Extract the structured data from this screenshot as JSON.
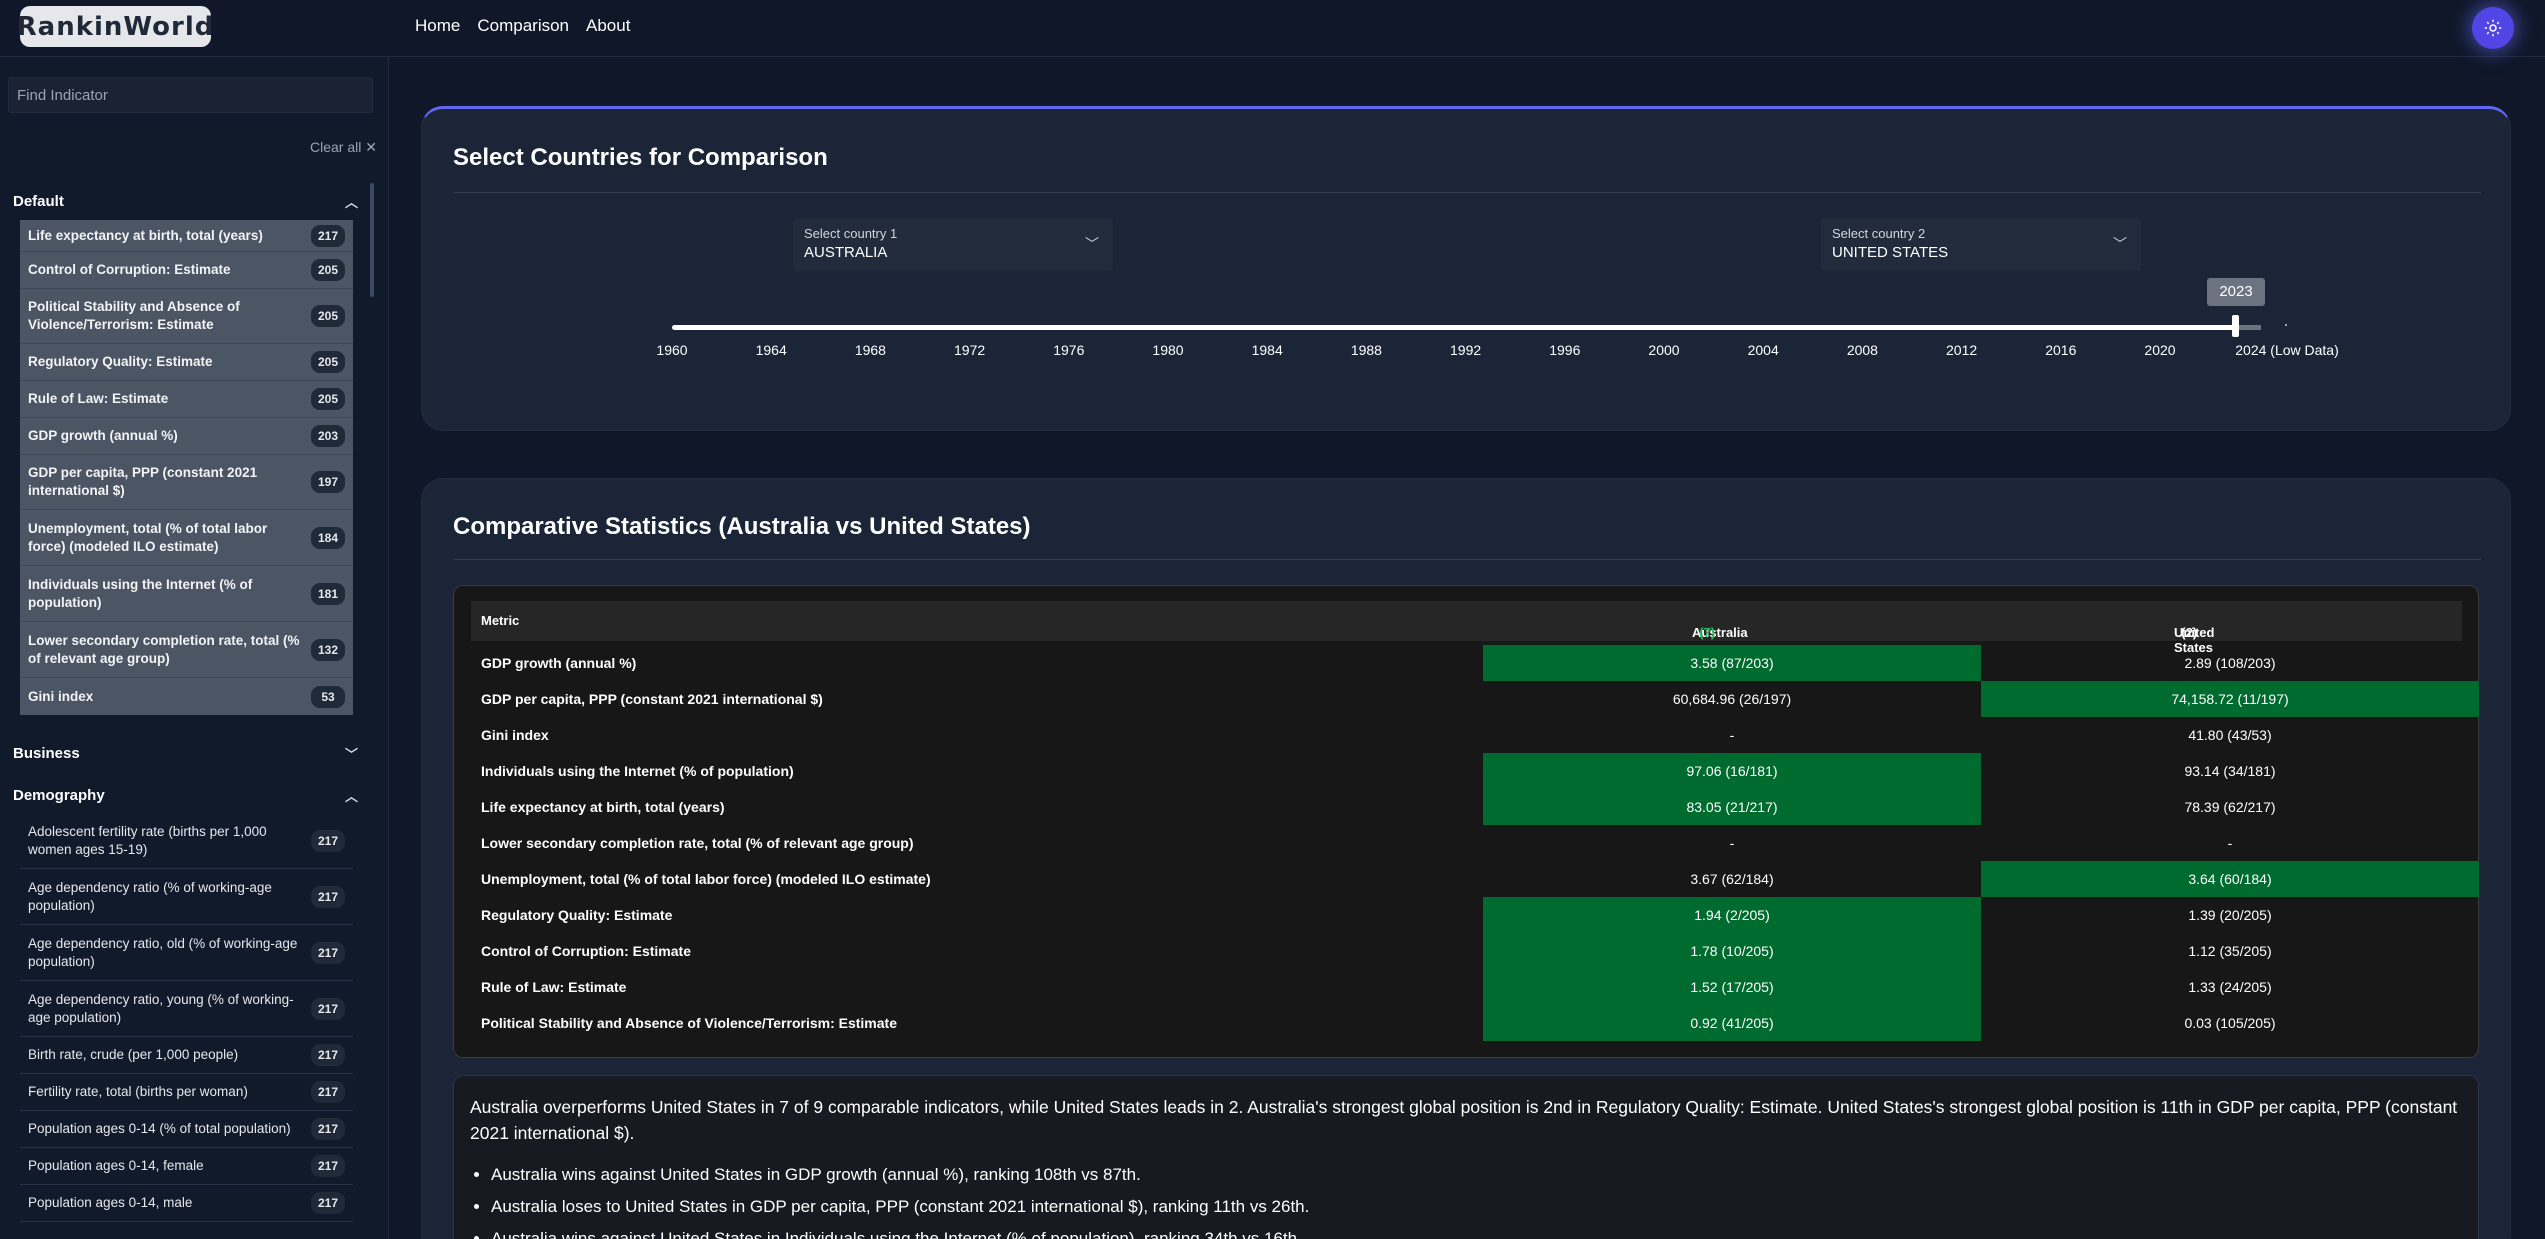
{
  "header": {
    "logo": "RankinWorld",
    "nav": [
      "Home",
      "Comparison",
      "About"
    ],
    "theme_icon": "sun-icon"
  },
  "sidebar": {
    "search_placeholder": "Find Indicator",
    "clear_all": "Clear all ✕",
    "sections": {
      "default": "Default",
      "business": "Business",
      "demography": "Demography"
    },
    "default_items": [
      {
        "label": "Life expectancy at birth, total (years)",
        "count": "217"
      },
      {
        "label": "Control of Corruption: Estimate",
        "count": "205"
      },
      {
        "label": "Political Stability and Absence of Violence/Terrorism: Estimate",
        "count": "205"
      },
      {
        "label": "Regulatory Quality: Estimate",
        "count": "205"
      },
      {
        "label": "Rule of Law: Estimate",
        "count": "205"
      },
      {
        "label": "GDP growth (annual %)",
        "count": "203"
      },
      {
        "label": "GDP per capita, PPP (constant 2021 international $)",
        "count": "197"
      },
      {
        "label": "Unemployment, total (% of total labor force) (modeled ILO estimate)",
        "count": "184"
      },
      {
        "label": "Individuals using the Internet (% of population)",
        "count": "181"
      },
      {
        "label": "Lower secondary completion rate, total (% of relevant age group)",
        "count": "132"
      },
      {
        "label": "Gini index",
        "count": "53"
      }
    ],
    "demography_items": [
      {
        "label": "Adolescent fertility rate (births per 1,000 women ages 15-19)",
        "count": "217"
      },
      {
        "label": "Age dependency ratio (% of working-age population)",
        "count": "217"
      },
      {
        "label": "Age dependency ratio, old (% of working-age population)",
        "count": "217"
      },
      {
        "label": "Age dependency ratio, young (% of working-age population)",
        "count": "217"
      },
      {
        "label": "Birth rate, crude (per 1,000 people)",
        "count": "217"
      },
      {
        "label": "Fertility rate, total (births per woman)",
        "count": "217"
      },
      {
        "label": "Population ages 0-14 (% of total population)",
        "count": "217"
      },
      {
        "label": "Population ages 0-14, female",
        "count": "217"
      },
      {
        "label": "Population ages 0-14, male",
        "count": "217"
      }
    ]
  },
  "selector": {
    "title": "Select Countries for Comparison",
    "country1_label": "Select country 1",
    "country1_value": "AUSTRALIA",
    "country2_label": "Select country 2",
    "country2_value": "UNITED STATES",
    "selected_year": "2023",
    "years": [
      "1960",
      "1964",
      "1968",
      "1972",
      "1976",
      "1980",
      "1984",
      "1988",
      "1992",
      "1996",
      "2000",
      "2004",
      "2008",
      "2012",
      "2016",
      "2020",
      "2024 (Low Data)"
    ]
  },
  "stats": {
    "title": "Comparative Statistics (Australia vs United States)",
    "col_metric": "Metric",
    "col_aus": "Australia",
    "col_aus_wins": "(7)",
    "col_us": "United States",
    "col_us_wins": "(2)",
    "rows": [
      {
        "metric": "GDP growth (annual %)",
        "aus": "3.58 (87/203)",
        "us": "2.89 (108/203)",
        "winner": "aus"
      },
      {
        "metric": "GDP per capita, PPP (constant 2021 international $)",
        "aus": "60,684.96 (26/197)",
        "us": "74,158.72 (11/197)",
        "winner": "us"
      },
      {
        "metric": "Gini index",
        "aus": "-",
        "us": "41.80 (43/53)",
        "winner": ""
      },
      {
        "metric": "Individuals using the Internet (% of population)",
        "aus": "97.06 (16/181)",
        "us": "93.14 (34/181)",
        "winner": "aus"
      },
      {
        "metric": "Life expectancy at birth, total (years)",
        "aus": "83.05 (21/217)",
        "us": "78.39 (62/217)",
        "winner": "aus"
      },
      {
        "metric": "Lower secondary completion rate, total (% of relevant age group)",
        "aus": "-",
        "us": "-",
        "winner": ""
      },
      {
        "metric": "Unemployment, total (% of total labor force) (modeled ILO estimate)",
        "aus": "3.67 (62/184)",
        "us": "3.64 (60/184)",
        "winner": "us"
      },
      {
        "metric": "Regulatory Quality: Estimate",
        "aus": "1.94 (2/205)",
        "us": "1.39 (20/205)",
        "winner": "aus"
      },
      {
        "metric": "Control of Corruption: Estimate",
        "aus": "1.78 (10/205)",
        "us": "1.12 (35/205)",
        "winner": "aus"
      },
      {
        "metric": "Rule of Law: Estimate",
        "aus": "1.52 (17/205)",
        "us": "1.33 (24/205)",
        "winner": "aus"
      },
      {
        "metric": "Political Stability and Absence of Violence/Terrorism: Estimate",
        "aus": "0.92 (41/205)",
        "us": "0.03 (105/205)",
        "winner": "aus"
      }
    ]
  },
  "summary": {
    "text": "Australia overperforms United States in 7 of 9 comparable indicators, while United States leads in 2. Australia's strongest global position is 2nd in Regulatory Quality: Estimate. United States's strongest global position is 11th in GDP per capita, PPP (constant 2021 international $).",
    "bullets": [
      "Australia wins against United States in GDP growth (annual %), ranking 108th vs 87th.",
      "Australia loses to United States in GDP per capita, PPP (constant 2021 international $), ranking 11th vs 26th.",
      "Australia wins against United States in Individuals using the Internet (% of population), ranking 34th vs 16th."
    ]
  },
  "colors": {
    "accent": "#6366f1",
    "win_cell": "#006b2e",
    "background": "#0f1728"
  }
}
